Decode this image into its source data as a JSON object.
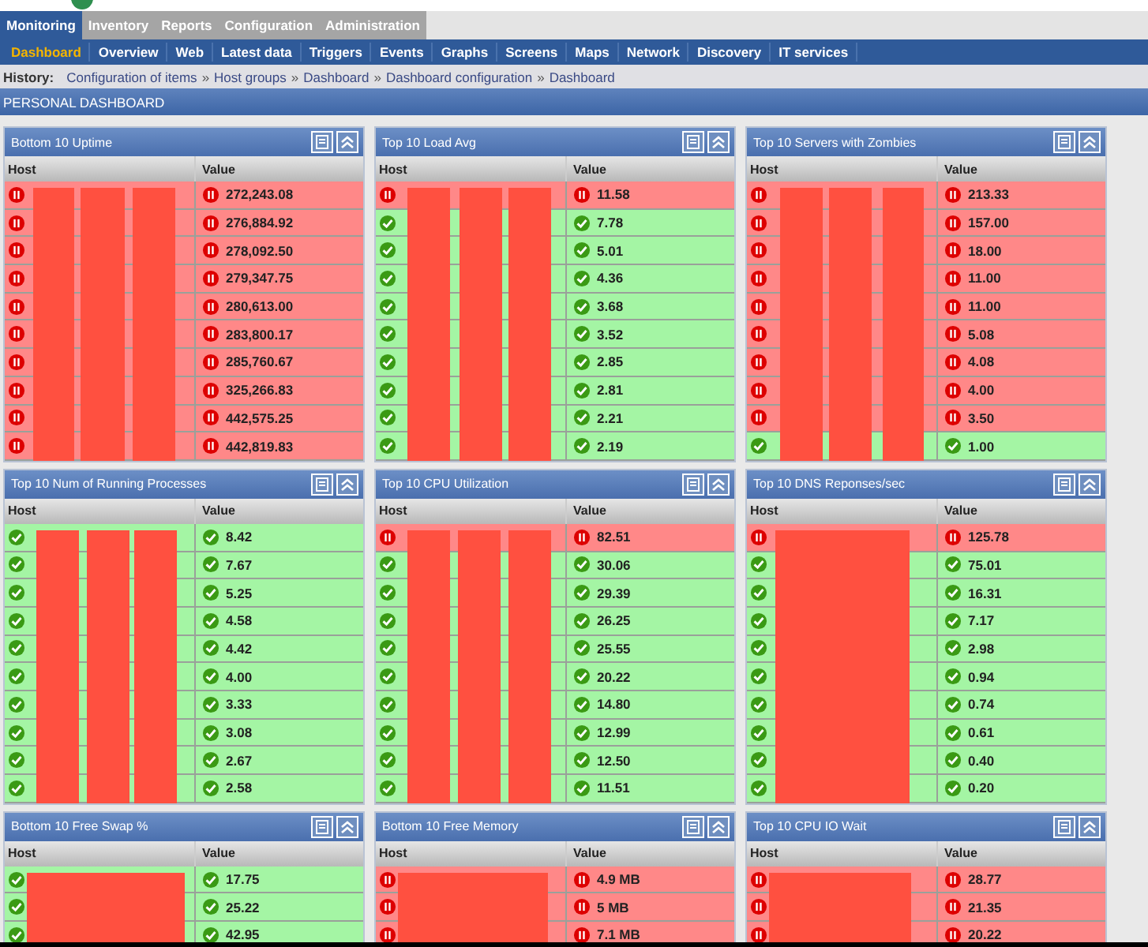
{
  "tabs": [
    {
      "label": "Monitoring",
      "selected": true
    },
    {
      "label": "Inventory",
      "selected": false
    },
    {
      "label": "Reports",
      "selected": false
    },
    {
      "label": "Configuration",
      "selected": false
    },
    {
      "label": "Administration",
      "selected": false
    }
  ],
  "submenu": [
    {
      "label": "Dashboard",
      "selected": true
    },
    {
      "label": "Overview",
      "selected": false
    },
    {
      "label": "Web",
      "selected": false
    },
    {
      "label": "Latest data",
      "selected": false
    },
    {
      "label": "Triggers",
      "selected": false
    },
    {
      "label": "Events",
      "selected": false
    },
    {
      "label": "Graphs",
      "selected": false
    },
    {
      "label": "Screens",
      "selected": false
    },
    {
      "label": "Maps",
      "selected": false
    },
    {
      "label": "Network",
      "selected": false
    },
    {
      "label": "Discovery",
      "selected": false
    },
    {
      "label": "IT services",
      "selected": false
    }
  ],
  "history": {
    "label": "History:",
    "items": [
      "Configuration of items",
      "Host groups",
      "Dashboard",
      "Dashboard configuration",
      "Dashboard"
    ],
    "separator": "»"
  },
  "page_title": "PERSONAL DASHBOARD",
  "widgets": [
    {
      "title": "Bottom 10 Uptime",
      "columns": [
        "Host",
        "Value"
      ],
      "rows": [
        {
          "problem": true,
          "value": "272,243.08"
        },
        {
          "problem": true,
          "value": "276,884.92"
        },
        {
          "problem": true,
          "value": "278,092.50"
        },
        {
          "problem": true,
          "value": "279,347.75"
        },
        {
          "problem": true,
          "value": "280,613.00"
        },
        {
          "problem": true,
          "value": "283,800.17"
        },
        {
          "problem": true,
          "value": "285,760.67"
        },
        {
          "problem": true,
          "value": "325,266.83"
        },
        {
          "problem": true,
          "value": "442,575.25"
        },
        {
          "problem": true,
          "value": "442,819.83"
        }
      ]
    },
    {
      "title": "Top 10 Load Avg",
      "columns": [
        "Host",
        "Value"
      ],
      "rows": [
        {
          "problem": true,
          "value": "11.58"
        },
        {
          "problem": false,
          "value": "7.78"
        },
        {
          "problem": false,
          "value": "5.01"
        },
        {
          "problem": false,
          "value": "4.36"
        },
        {
          "problem": false,
          "value": "3.68"
        },
        {
          "problem": false,
          "value": "3.52"
        },
        {
          "problem": false,
          "value": "2.85"
        },
        {
          "problem": false,
          "value": "2.81"
        },
        {
          "problem": false,
          "value": "2.21"
        },
        {
          "problem": false,
          "value": "2.19"
        }
      ]
    },
    {
      "title": "Top 10 Servers with Zombies",
      "columns": [
        "Host",
        "Value"
      ],
      "rows": [
        {
          "problem": true,
          "value": "213.33"
        },
        {
          "problem": true,
          "value": "157.00"
        },
        {
          "problem": true,
          "value": "18.00"
        },
        {
          "problem": true,
          "value": "11.00"
        },
        {
          "problem": true,
          "value": "11.00"
        },
        {
          "problem": true,
          "value": "5.08"
        },
        {
          "problem": true,
          "value": "4.08"
        },
        {
          "problem": true,
          "value": "4.00"
        },
        {
          "problem": true,
          "value": "3.50"
        },
        {
          "problem": false,
          "value": "1.00"
        }
      ]
    },
    {
      "title": "Top 10 Num of Running Processes",
      "columns": [
        "Host",
        "Value"
      ],
      "rows": [
        {
          "problem": false,
          "value": "8.42"
        },
        {
          "problem": false,
          "value": "7.67"
        },
        {
          "problem": false,
          "value": "5.25"
        },
        {
          "problem": false,
          "value": "4.58"
        },
        {
          "problem": false,
          "value": "4.42"
        },
        {
          "problem": false,
          "value": "4.00"
        },
        {
          "problem": false,
          "value": "3.33"
        },
        {
          "problem": false,
          "value": "3.08"
        },
        {
          "problem": false,
          "value": "2.67"
        },
        {
          "problem": false,
          "value": "2.58"
        }
      ]
    },
    {
      "title": "Top 10 CPU Utilization",
      "columns": [
        "Host",
        "Value"
      ],
      "rows": [
        {
          "problem": true,
          "value": "82.51"
        },
        {
          "problem": false,
          "value": "30.06"
        },
        {
          "problem": false,
          "value": "29.39"
        },
        {
          "problem": false,
          "value": "26.25"
        },
        {
          "problem": false,
          "value": "25.55"
        },
        {
          "problem": false,
          "value": "20.22"
        },
        {
          "problem": false,
          "value": "14.80"
        },
        {
          "problem": false,
          "value": "12.99"
        },
        {
          "problem": false,
          "value": "12.50"
        },
        {
          "problem": false,
          "value": "11.51"
        }
      ]
    },
    {
      "title": "Top 10 DNS Reponses/sec",
      "columns": [
        "Host",
        "Value"
      ],
      "rows": [
        {
          "problem": true,
          "value": "125.78"
        },
        {
          "problem": false,
          "value": "75.01"
        },
        {
          "problem": false,
          "value": "16.31"
        },
        {
          "problem": false,
          "value": "7.17"
        },
        {
          "problem": false,
          "value": "2.98"
        },
        {
          "problem": false,
          "value": "0.94"
        },
        {
          "problem": false,
          "value": "0.74"
        },
        {
          "problem": false,
          "value": "0.61"
        },
        {
          "problem": false,
          "value": "0.40"
        },
        {
          "problem": false,
          "value": "0.20"
        }
      ]
    },
    {
      "title": "Bottom 10 Free Swap %",
      "columns": [
        "Host",
        "Value"
      ],
      "rows": [
        {
          "problem": false,
          "value": "17.75"
        },
        {
          "problem": false,
          "value": "25.22"
        },
        {
          "problem": false,
          "value": "42.95"
        }
      ]
    },
    {
      "title": "Bottom 10 Free Memory",
      "columns": [
        "Host",
        "Value"
      ],
      "rows": [
        {
          "problem": true,
          "value": "4.9 MB"
        },
        {
          "problem": true,
          "value": "5 MB"
        },
        {
          "problem": true,
          "value": "7.1 MB"
        }
      ]
    },
    {
      "title": "Top 10 CPU IO Wait",
      "columns": [
        "Host",
        "Value"
      ],
      "rows": [
        {
          "problem": true,
          "value": "28.77"
        },
        {
          "problem": true,
          "value": "21.35"
        },
        {
          "problem": true,
          "value": "20.22"
        }
      ]
    }
  ]
}
